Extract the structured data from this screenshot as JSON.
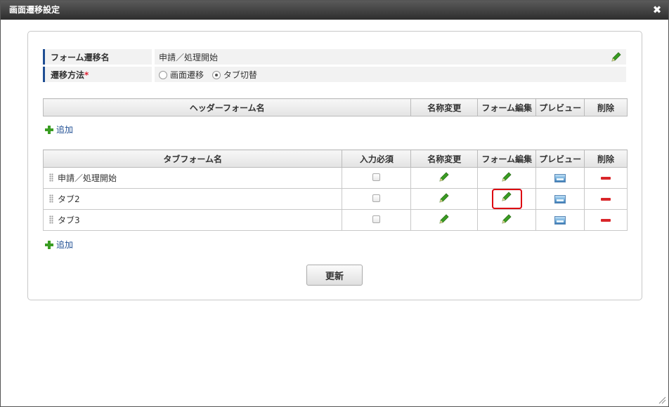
{
  "dialog": {
    "title": "画面遷移設定"
  },
  "info": {
    "form_name_label": "フォーム遷移名",
    "form_name_value": "申請／処理開始",
    "method_label": "遷移方法",
    "required_mark": "*",
    "options": [
      {
        "label": "画面遷移",
        "checked": false
      },
      {
        "label": "タブ切替",
        "checked": true
      }
    ]
  },
  "header_table": {
    "columns": [
      "ヘッダーフォーム名",
      "名称変更",
      "フォーム編集",
      "プレビュー",
      "削除"
    ],
    "add_label": "追加"
  },
  "tab_table": {
    "columns": [
      "タブフォーム名",
      "入力必須",
      "名称変更",
      "フォーム編集",
      "プレビュー",
      "削除"
    ],
    "rows": [
      {
        "name": "申請／処理開始"
      },
      {
        "name": "タブ2"
      },
      {
        "name": "タブ3"
      }
    ],
    "add_label": "追加"
  },
  "update_label": "更新",
  "colors": {
    "accent": "#1f4e93",
    "highlight": "#dd0011",
    "pencil": "#3a9d23",
    "delete": "#d9262a"
  }
}
